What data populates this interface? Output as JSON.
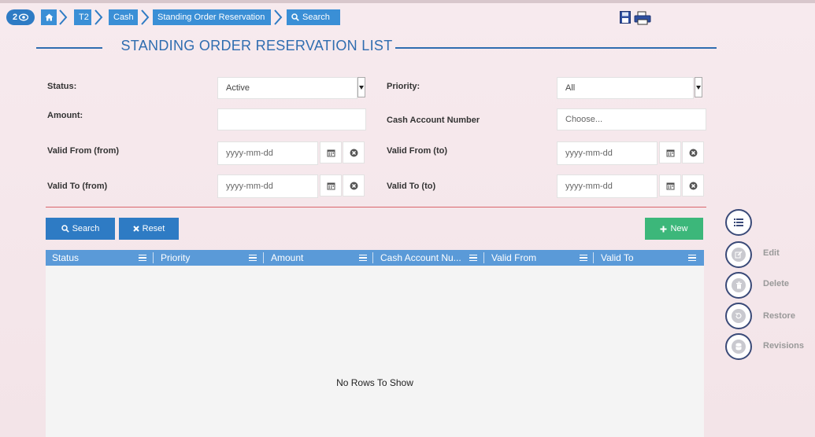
{
  "breadcrumb": {
    "badge": "2",
    "items": [
      {
        "label": "T2"
      },
      {
        "label": "Cash"
      },
      {
        "label": "Standing Order Reservation"
      },
      {
        "label": "Search"
      }
    ]
  },
  "page": {
    "title": "STANDING ORDER RESERVATION LIST"
  },
  "form": {
    "status": {
      "label": "Status:",
      "value": "Active"
    },
    "priority": {
      "label": "Priority:",
      "value": "All"
    },
    "amount": {
      "label": "Amount:",
      "value": ""
    },
    "cash_account": {
      "label": "Cash Account Number",
      "placeholder": "Choose..."
    },
    "valid_from_from": {
      "label": "Valid From (from)",
      "placeholder": "yyyy-mm-dd"
    },
    "valid_from_to": {
      "label": "Valid From (to)",
      "placeholder": "yyyy-mm-dd"
    },
    "valid_to_from": {
      "label": "Valid To (from)",
      "placeholder": "yyyy-mm-dd"
    },
    "valid_to_to": {
      "label": "Valid To (to)",
      "placeholder": "yyyy-mm-dd"
    }
  },
  "buttons": {
    "search": "Search",
    "reset": "Reset",
    "new": "New"
  },
  "grid": {
    "columns": [
      "Status",
      "Priority",
      "Amount",
      "Cash Account Nu...",
      "Valid From",
      "Valid To"
    ],
    "empty_message": "No Rows To Show"
  },
  "side_actions": {
    "edit": "Edit",
    "delete": "Delete",
    "restore": "Restore",
    "revisions": "Revisions"
  },
  "colors": {
    "primary": "#2e7bc4",
    "header": "#5a9ad8",
    "green": "#3cb77a",
    "title": "#2f6db0"
  }
}
